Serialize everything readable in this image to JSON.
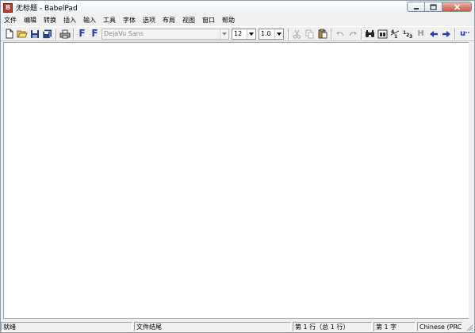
{
  "window": {
    "title": "无标题 - BabelPad",
    "app_icon_glyph": "B",
    "controls": [
      "minimize-icon",
      "maximize-icon",
      "close-icon"
    ]
  },
  "menu": {
    "items": [
      "文件",
      "编辑",
      "转换",
      "插入",
      "输入",
      "工具",
      "字体",
      "选项",
      "布局",
      "视图",
      "窗口",
      "帮助"
    ]
  },
  "toolbar": {
    "font_name": "DejaVu Sans",
    "font_size": "12",
    "line_spacing": "1.0",
    "bold_f_1": "F",
    "bold_f_2": "F",
    "unicode_upper": "u",
    "umlaut_u": "ü",
    "h_label": "H",
    "digits_label_1": "41",
    "digits_label_2": "123"
  },
  "statusbar": {
    "state": "就绪",
    "position_hint": "文件结尾",
    "line_info": "第 1 行（总 1 行）",
    "char_info": "第 1 字",
    "locale": "Chinese (PRC)"
  },
  "colors": {
    "accent_blue": "#1c3fb0",
    "close_red": "#c95a45",
    "app_icon_red": "#c0392b"
  }
}
